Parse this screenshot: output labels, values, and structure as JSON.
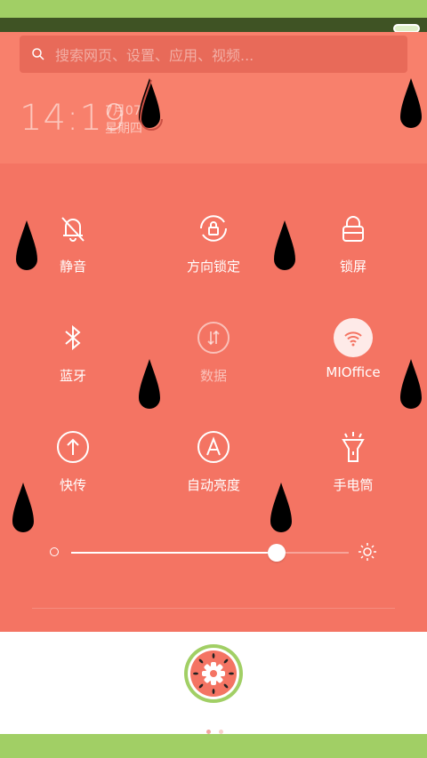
{
  "search": {
    "placeholder": "搜索网页、设置、应用、视频..."
  },
  "clock": {
    "time": "14:19",
    "date": "7月07日",
    "weekday": "星期四"
  },
  "toggles": [
    {
      "label": "静音",
      "icon": "mute-bell-icon",
      "state": "on"
    },
    {
      "label": "方向锁定",
      "icon": "rotation-lock-icon",
      "state": "on"
    },
    {
      "label": "锁屏",
      "icon": "lock-icon",
      "state": "on"
    },
    {
      "label": "蓝牙",
      "icon": "bluetooth-icon",
      "state": "on"
    },
    {
      "label": "数据",
      "icon": "mobile-data-icon",
      "state": "off"
    },
    {
      "label": "MIOffice",
      "icon": "wifi-icon",
      "state": "active"
    },
    {
      "label": "快传",
      "icon": "quick-transfer-icon",
      "state": "on"
    },
    {
      "label": "自动亮度",
      "icon": "auto-brightness-icon",
      "state": "on"
    },
    {
      "label": "手电筒",
      "icon": "flashlight-icon",
      "state": "on"
    }
  ],
  "brightness": {
    "level": 0.74
  },
  "dock": {
    "app_icon": "watermelon-settings-icon"
  },
  "page_indicator": {
    "count": 2,
    "active": 0
  },
  "colors": {
    "accent_green": "#a1cf65",
    "panel": "#f47463",
    "header": "#f8806c",
    "seed": "#000000"
  }
}
